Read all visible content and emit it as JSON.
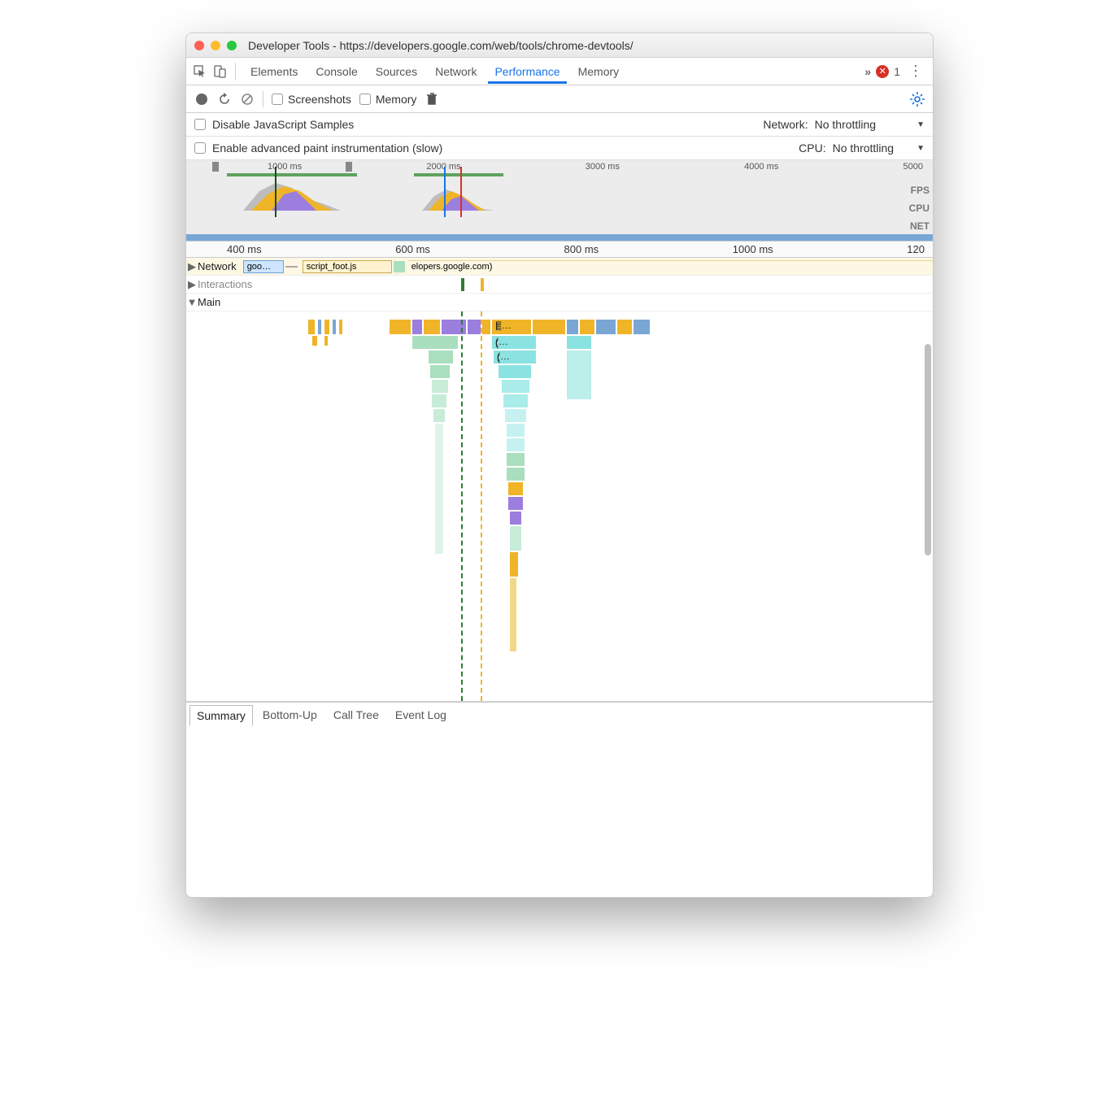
{
  "window": {
    "title": "Developer Tools - https://developers.google.com/web/tools/chrome-devtools/"
  },
  "traffic": {
    "close": "#ff5f57",
    "min": "#ffbd2e",
    "max": "#28c940"
  },
  "tabs": {
    "items": [
      "Elements",
      "Console",
      "Sources",
      "Network",
      "Performance",
      "Memory"
    ],
    "active": "Performance",
    "errors": "1"
  },
  "toolbar": {
    "screenshots_label": "Screenshots",
    "memory_label": "Memory"
  },
  "settings": {
    "disable_js_label": "Disable JavaScript Samples",
    "enable_paint_label": "Enable advanced paint instrumentation (slow)",
    "network_label": "Network:",
    "network_value": "No throttling",
    "cpu_label": "CPU:",
    "cpu_value": "No throttling"
  },
  "overview": {
    "ticks": [
      "1000 ms",
      "2000 ms",
      "3000 ms",
      "4000 ms",
      "5000"
    ],
    "lanes": [
      "FPS",
      "CPU",
      "NET"
    ]
  },
  "detail_ruler": [
    "400 ms",
    "600 ms",
    "800 ms",
    "1000 ms",
    "120"
  ],
  "tracks": {
    "network_label": "Network",
    "network_item1": "goo…",
    "network_item2": "script_foot.js",
    "network_item3": "elopers.google.com)",
    "interactions_label": "Interactions",
    "main_label": "Main"
  },
  "flame": {
    "block1": "E…",
    "block2": "(…",
    "block3": "(…"
  },
  "bottom_tabs": {
    "items": [
      "Summary",
      "Bottom-Up",
      "Call Tree",
      "Event Log"
    ],
    "active": "Summary"
  },
  "colors": {
    "orange": "#f0b429",
    "purple": "#9b7ede",
    "blue": "#7aa6d6",
    "teal": "#8be3e1",
    "green": "#a9dfbf",
    "darkgreen": "#63b28a"
  }
}
